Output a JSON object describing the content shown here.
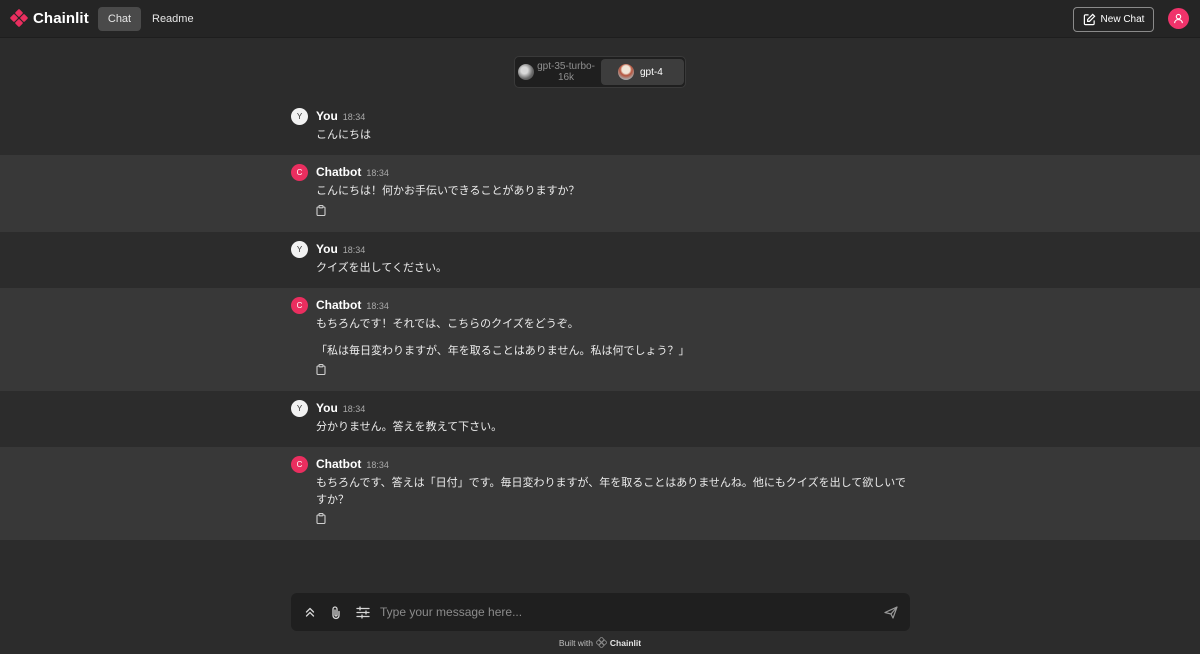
{
  "app": {
    "name": "Chainlit",
    "accent": "#f0336b"
  },
  "header": {
    "tabs": [
      "Chat",
      "Readme"
    ],
    "new_chat_label": "New Chat"
  },
  "models": [
    {
      "label": "gpt-35-turbo-16k",
      "active": false
    },
    {
      "label": "gpt-4",
      "active": true
    }
  ],
  "messages": [
    {
      "role": "user",
      "avatar": "Y",
      "author": "You",
      "time": "18:34",
      "text": [
        "こんにちは"
      ]
    },
    {
      "role": "bot",
      "avatar": "C",
      "author": "Chatbot",
      "time": "18:34",
      "text": [
        "こんにちは！何かお手伝いできることがありますか？"
      ]
    },
    {
      "role": "user",
      "avatar": "Y",
      "author": "You",
      "time": "18:34",
      "text": [
        "クイズを出してください。"
      ]
    },
    {
      "role": "bot",
      "avatar": "C",
      "author": "Chatbot",
      "time": "18:34",
      "text": [
        "もちろんです！それでは、こちらのクイズをどうぞ。",
        "「私は毎日変わりますが、年を取ることはありません。私は何でしょう？」"
      ]
    },
    {
      "role": "user",
      "avatar": "Y",
      "author": "You",
      "time": "18:34",
      "text": [
        "分かりません。答えを教えて下さい。"
      ]
    },
    {
      "role": "bot",
      "avatar": "C",
      "author": "Chatbot",
      "time": "18:34",
      "text": [
        "もちろんです、答えは「日付」です。毎日変わりますが、年を取ることはありませんね。他にもクイズを出して欲しいですか？"
      ]
    }
  ],
  "input": {
    "placeholder": "Type your message here..."
  },
  "footer": {
    "prefix": "Built with",
    "brand": "Chainlit"
  }
}
